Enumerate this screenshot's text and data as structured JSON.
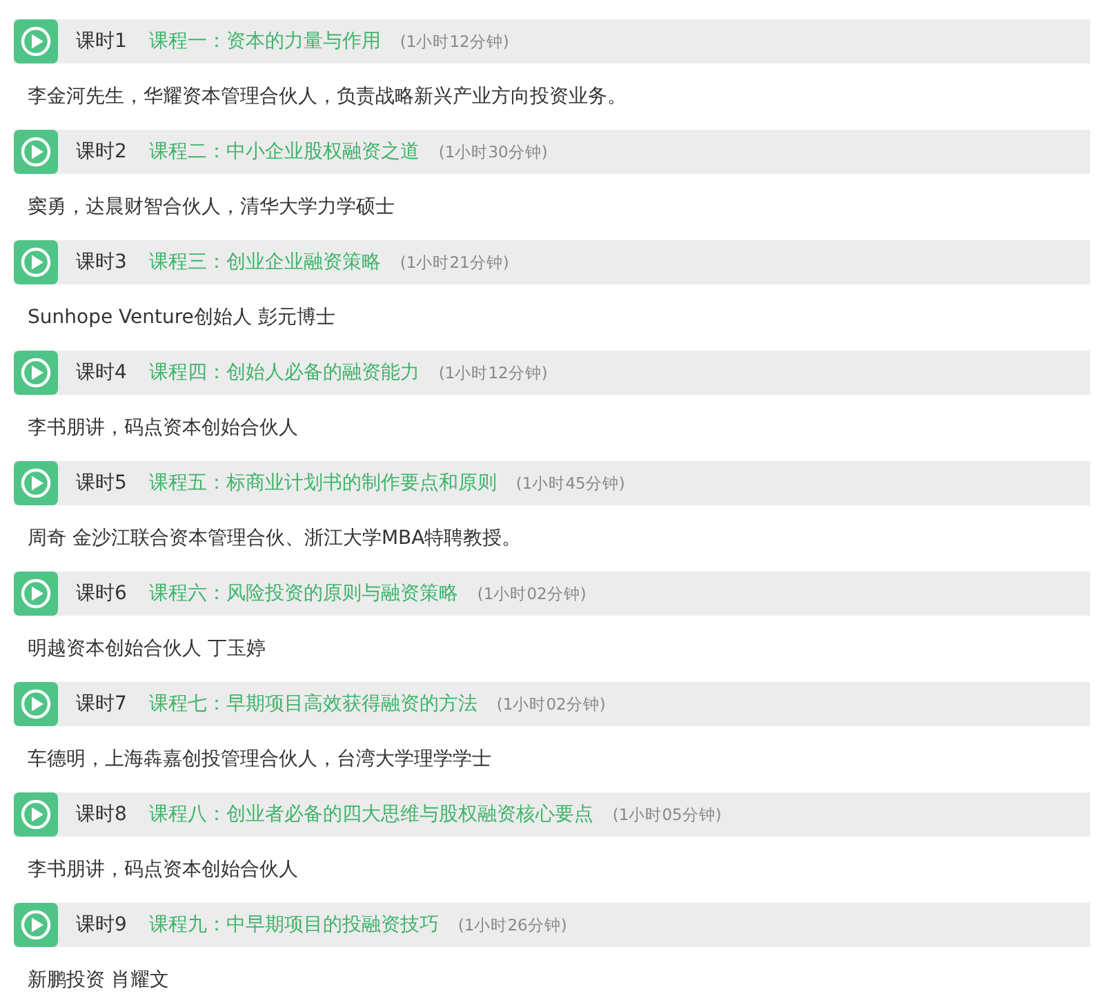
{
  "lessons": [
    {
      "label": "课时1",
      "title": "课程一：资本的力量与作用",
      "duration": "(1小时12分钟)",
      "description": "李金河先生，华耀资本管理合伙人，负责战略新兴产业方向投资业务。"
    },
    {
      "label": "课时2",
      "title": "课程二：中小企业股权融资之道",
      "duration": "(1小时30分钟)",
      "description": "窦勇，达晨财智合伙人，清华大学力学硕士"
    },
    {
      "label": "课时3",
      "title": "课程三：创业企业融资策略",
      "duration": "(1小时21分钟)",
      "description": "Sunhope Venture创始人 彭元博士"
    },
    {
      "label": "课时4",
      "title": "课程四：创始人必备的融资能力",
      "duration": "(1小时12分钟)",
      "description": "李书朋讲，码点资本创始合伙人"
    },
    {
      "label": "课时5",
      "title": "课程五：标商业计划书的制作要点和原则",
      "duration": "(1小时45分钟)",
      "description": "周奇 金沙江联合资本管理合伙、浙江大学MBA特聘教授。"
    },
    {
      "label": "课时6",
      "title": "课程六：风险投资的原则与融资策略",
      "duration": "(1小时02分钟)",
      "description": "明越资本创始合伙人 丁玉婷"
    },
    {
      "label": "课时7",
      "title": "课程七：早期项目高效获得融资的方法",
      "duration": "(1小时02分钟)",
      "description": "车德明，上海犇嘉创投管理合伙人，台湾大学理学学士"
    },
    {
      "label": "课时8",
      "title": "课程八：创业者必备的四大思维与股权融资核心要点",
      "duration": "(1小时05分钟)",
      "description": "李书朋讲，码点资本创始合伙人"
    },
    {
      "label": "课时9",
      "title": "课程九：中早期项目的投融资技巧",
      "duration": "(1小时26分钟)",
      "description": "新鹏投资 肖耀文"
    }
  ]
}
